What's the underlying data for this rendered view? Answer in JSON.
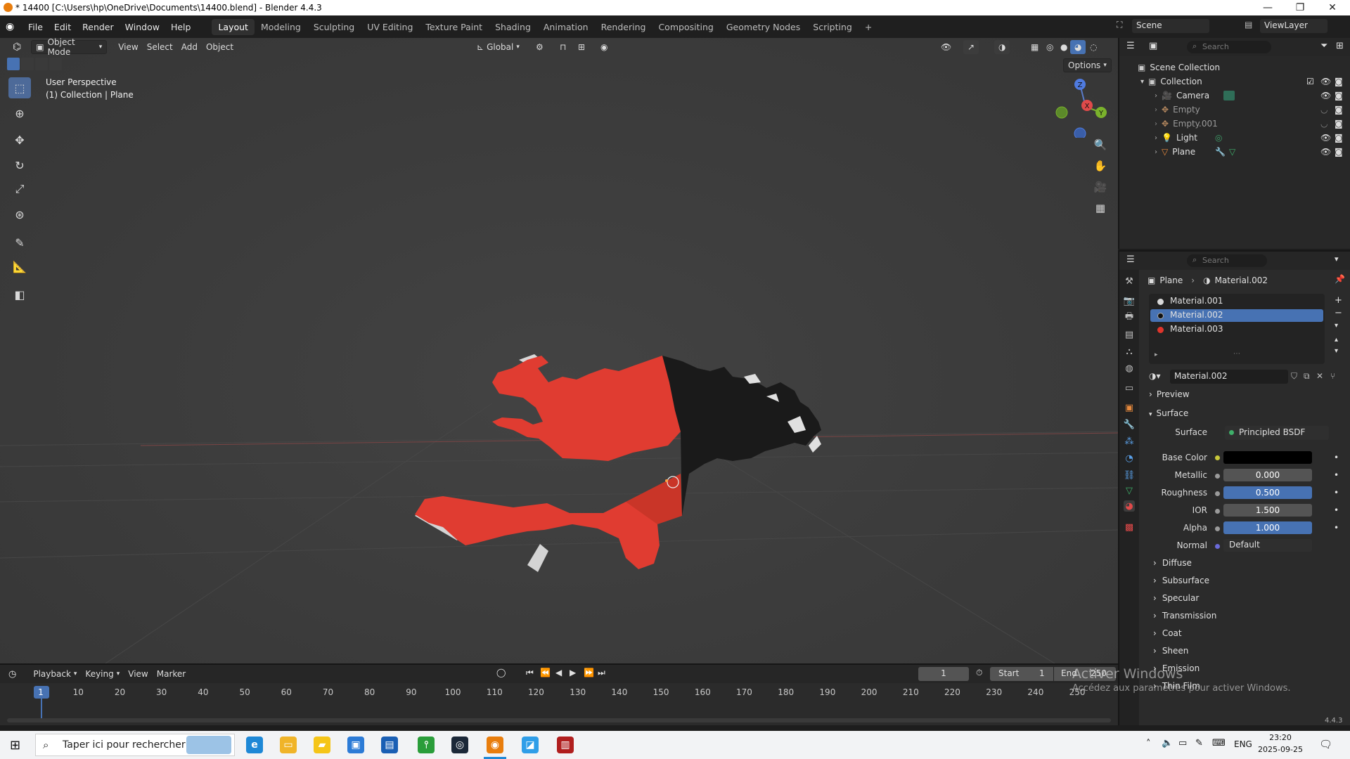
{
  "window": {
    "title": "* 14400 [C:\\Users\\hp\\OneDrive\\Documents\\14400.blend] - Blender 4.4.3",
    "minimize": "—",
    "maximize": "❐",
    "close": "✕"
  },
  "menu": [
    "File",
    "Edit",
    "Render",
    "Window",
    "Help"
  ],
  "workspaces": [
    "Layout",
    "Modeling",
    "Sculpting",
    "UV Editing",
    "Texture Paint",
    "Shading",
    "Animation",
    "Rendering",
    "Compositing",
    "Geometry Nodes",
    "Scripting"
  ],
  "workspace_add": "+",
  "scene": {
    "name": "Scene",
    "view_layer": "ViewLayer"
  },
  "viewport": {
    "mode": "Object Mode",
    "menus": [
      "View",
      "Select",
      "Add",
      "Object"
    ],
    "transform_orientation": "Global",
    "options": "Options",
    "perspective_label": "User Perspective",
    "collection_label": "(1) Collection | Plane",
    "gizmo": {
      "z": "Z",
      "y": "Y",
      "x": "X"
    }
  },
  "outliner": {
    "search_placeholder": "Search",
    "root": "Scene Collection",
    "collection": "Collection",
    "items": [
      {
        "name": "Camera",
        "visible": true
      },
      {
        "name": "Empty",
        "visible": false
      },
      {
        "name": "Empty.001",
        "visible": false
      },
      {
        "name": "Light",
        "visible": true
      },
      {
        "name": "Plane",
        "visible": true
      }
    ]
  },
  "properties": {
    "search_placeholder": "Search",
    "breadcrumb_object": "Plane",
    "breadcrumb_material": "Material.002",
    "slots": [
      {
        "name": "Material.001",
        "color": "#d9d9d9",
        "selected": false
      },
      {
        "name": "Material.002",
        "color": "#111111",
        "selected": true
      },
      {
        "name": "Material.003",
        "color": "#e0352b",
        "selected": false
      }
    ],
    "material_name": "Material.002",
    "sections": {
      "preview": "Preview",
      "surface": "Surface"
    },
    "surface_label": "Surface",
    "surface_value": "Principled BSDF",
    "base_color_label": "Base Color",
    "base_color": "#000000",
    "fields": [
      {
        "label": "Metallic",
        "value": "0.000",
        "fill": 0.0
      },
      {
        "label": "Roughness",
        "value": "0.500",
        "fill": 1.0
      },
      {
        "label": "IOR",
        "value": "1.500",
        "fill": 0.0
      },
      {
        "label": "Alpha",
        "value": "1.000",
        "fill": 1.0
      }
    ],
    "normal_label": "Normal",
    "normal_value": "Default",
    "subsections": [
      "Diffuse",
      "Subsurface",
      "Specular",
      "Transmission",
      "Coat",
      "Sheen",
      "Emission",
      "Thin Film"
    ]
  },
  "timeline": {
    "menus": [
      "Playback",
      "Keying",
      "View",
      "Marker"
    ],
    "current_frame": "1",
    "start_label": "Start",
    "start": "1",
    "end_label": "End",
    "end": "250",
    "ticks": [
      "1",
      "10",
      "20",
      "30",
      "40",
      "50",
      "60",
      "70",
      "80",
      "90",
      "100",
      "110",
      "120",
      "130",
      "140",
      "150",
      "160",
      "170",
      "180",
      "190",
      "200",
      "210",
      "220",
      "230",
      "240",
      "250"
    ]
  },
  "watermark": {
    "line1": "Activer Windows",
    "line2": "Accédez aux paramètres pour activer Windows."
  },
  "version": "4.4.3",
  "taskbar": {
    "search_placeholder": "Taper ici pour rechercher",
    "lang": "ENG",
    "time": "23:20",
    "date": "2025-09-25"
  },
  "colors": {
    "accent": "#4772b3",
    "haiti_red": "#e03c31",
    "dr_black": "#1a1a1a"
  }
}
